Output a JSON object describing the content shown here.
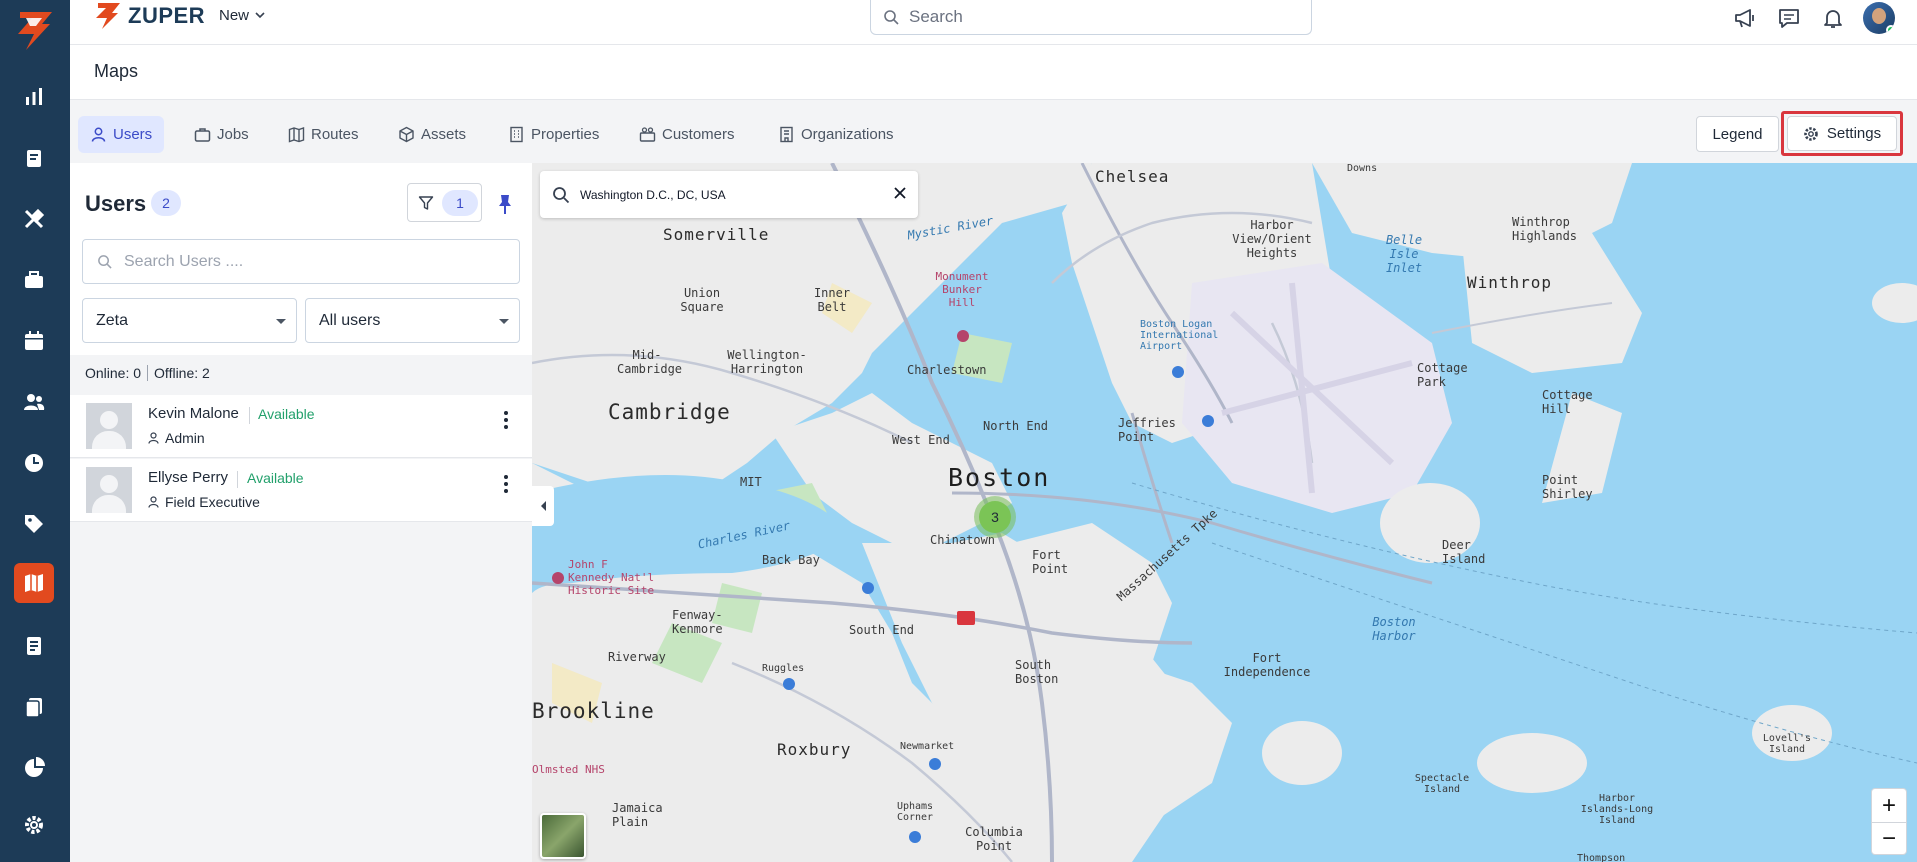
{
  "app": {
    "brand": "ZUPER",
    "new_label": "New"
  },
  "topbar": {
    "search_placeholder": "Search"
  },
  "page": {
    "title": "Maps"
  },
  "tabs": [
    {
      "label": "Users",
      "icon": "user-icon",
      "active": true
    },
    {
      "label": "Jobs",
      "icon": "briefcase-icon"
    },
    {
      "label": "Routes",
      "icon": "map-icon"
    },
    {
      "label": "Assets",
      "icon": "cube-icon"
    },
    {
      "label": "Properties",
      "icon": "building-icon"
    },
    {
      "label": "Customers",
      "icon": "customers-icon"
    },
    {
      "label": "Organizations",
      "icon": "organization-icon"
    }
  ],
  "actions": {
    "legend": "Legend",
    "settings": "Settings"
  },
  "users_panel": {
    "title": "Users",
    "count": "2",
    "filter_count": "1",
    "search_placeholder": "Search Users ....",
    "team_select": "Zeta",
    "user_select": "All users",
    "online_label": "Online: 0",
    "offline_label": "Offline: 2",
    "users": [
      {
        "name": "Kevin Malone",
        "status": "Available",
        "role": "Admin"
      },
      {
        "name": "Ellyse Perry",
        "status": "Available",
        "role": "Field Executive"
      }
    ]
  },
  "map": {
    "search_value": "Washington D.C., DC, USA",
    "cluster_count": "3",
    "zoom_in": "+",
    "zoom_out": "−",
    "labels": {
      "chelsea": "Chelsea",
      "somerville": "Somerville",
      "cambridge": "Cambridge",
      "boston": "Boston",
      "winthrop": "Winthrop",
      "winthrop_highlands": "Winthrop Highlands",
      "brookline": "Brookline",
      "roxbury": "Roxbury",
      "charlestown": "Charlestown",
      "south_boston": "South Boston",
      "back_bay": "Back Bay",
      "south_end": "South End",
      "fenway": "Fenway-Kenmore",
      "jamaica_plain": "Jamaica Plain",
      "fort_point": "Fort Point",
      "north_end": "North End",
      "west_end": "West End",
      "chinatown": "Chinatown",
      "jeffries_point": "Jeffries Point",
      "cottage_park": "Cottage Park",
      "cottage_hill": "Cottage Hill",
      "point_shirley": "Point Shirley",
      "deer_island": "Deer Island",
      "fort_independence": "Fort Independence",
      "boston_harbor": "Boston Harbor",
      "harbor_view": "Harbor View/Orient Heights",
      "union_square": "Union Square",
      "inner_belt": "Inner Belt",
      "mid_cambridge": "Mid-Cambridge",
      "wellington_harrington": "Wellington-Harrington",
      "mit": "MIT",
      "riverway": "Riverway",
      "charles_river": "Charles River",
      "mystic_river": "Mystic River",
      "belle_isle": "Belle Isle Inlet",
      "logan": "Boston Logan International Airport",
      "massachusetts_tpke": "Massachusetts Tpke",
      "spectacle": "Spectacle Island",
      "long_island": "Harbor Islands-Long Island",
      "lovells": "Lovell's Island",
      "columbia_point": "Columbia Point",
      "uphams": "Uphams Corner",
      "newmarket": "Newmarket",
      "downs": "Downs",
      "jfk_site": "John F Kennedy Nat'l Historic Site",
      "olmsted": "Olmsted NHS",
      "bunker_hill": "Monument Bunker Hill",
      "ruggles": "Ruggles",
      "thompson": "Thompson"
    }
  }
}
